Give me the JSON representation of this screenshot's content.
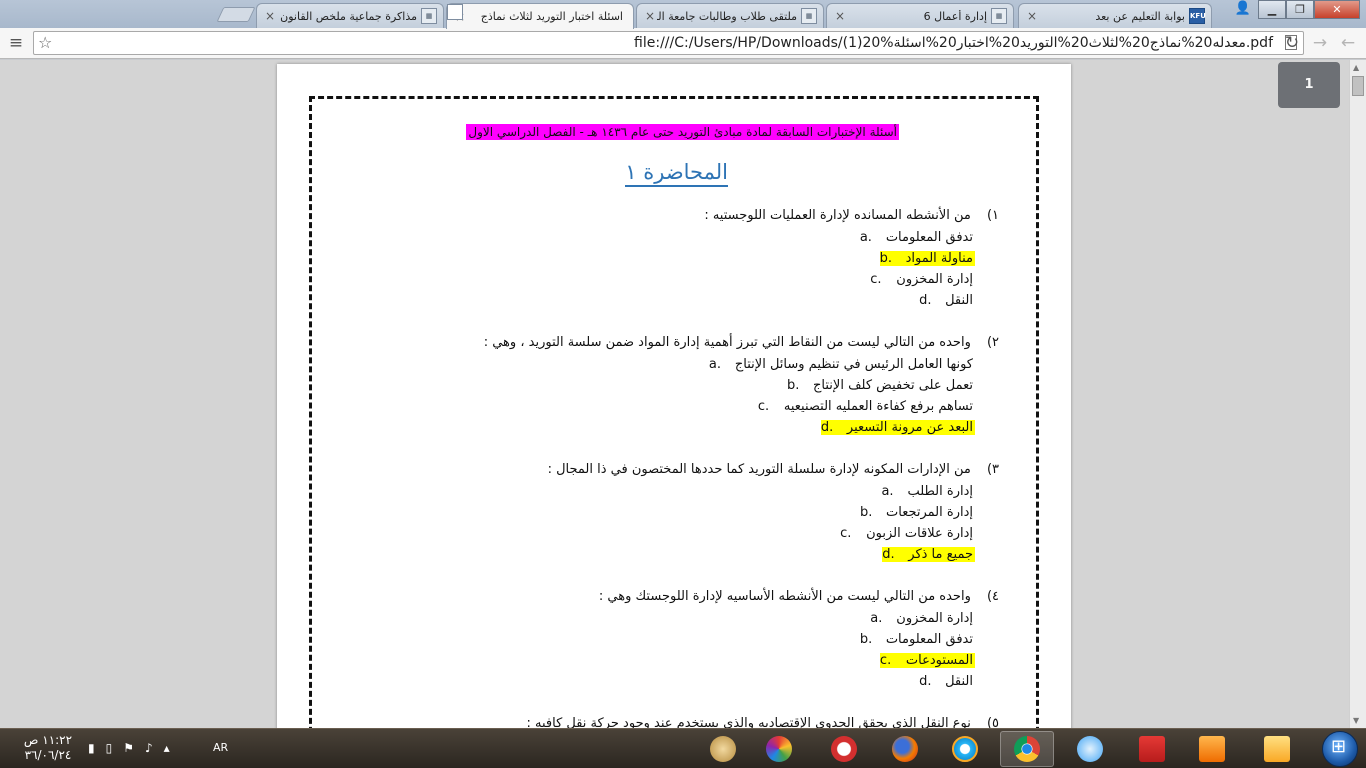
{
  "browser": {
    "tabs": [
      {
        "title": "بوابة التعليم عن بعد",
        "favicon": "KFU"
      },
      {
        "title": "إدارة أعمال 6",
        "favicon": ""
      },
      {
        "title": "ملتقى طلاب وطالبات جامعة الملك",
        "favicon": ""
      },
      {
        "title": "اسئلة اختبار التوريد لثلاث نماذج",
        "favicon": ""
      },
      {
        "title": "مذاكرة جماعية ملخص القانون التج",
        "favicon": ""
      }
    ],
    "tab_close_glyph": "×",
    "address": "file:///C:/Users/HP/Downloads/(1)20%معدله20%نماذج20%لثلاث20%التوريد20%اختبار20%اسئلة.pdf"
  },
  "viewer": {
    "page_indicator": "1",
    "document": {
      "header": "أسئلة الإختبارات السابقة لمادة مبادئ التوريد حتى عام ١٤٣٦ هـ - الفصل الدراسي الاول",
      "lecture_title": "المحاضرة ١",
      "questions": [
        {
          "num": "١)",
          "text": "من الأنشطه المسانده لإدارة العمليات اللوجستيه :",
          "options": [
            {
              "letter": "a.",
              "text": "تدفق المعلومات",
              "correct": false
            },
            {
              "letter": "b.",
              "text": "مناولة المواد",
              "correct": true
            },
            {
              "letter": "c.",
              "text": "إدارة المخزون",
              "correct": false
            },
            {
              "letter": "d.",
              "text": "النقل",
              "correct": false
            }
          ]
        },
        {
          "num": "٢)",
          "text": "واحده من التالي ليست من النقاط التي تبرز أهمية إدارة المواد ضمن سلسة التوريد ، وهي :",
          "options": [
            {
              "letter": "a.",
              "text": "كونها العامل الرئيس في تنظيم وسائل الإنتاج",
              "correct": false
            },
            {
              "letter": "b.",
              "text": "تعمل على تخفيض كلف الإنتاج",
              "correct": false
            },
            {
              "letter": "c.",
              "text": "تساهم برفع كفاءة العمليه التصنيعيه",
              "correct": false
            },
            {
              "letter": "d.",
              "text": "البعد عن مرونة التسعير",
              "correct": true
            }
          ]
        },
        {
          "num": "٣)",
          "text": "من الإدارات المكونه لإدارة سلسلة التوريد كما حددها المختصون في ذا المجال :",
          "options": [
            {
              "letter": "a.",
              "text": "إدارة الطلب",
              "correct": false
            },
            {
              "letter": "b.",
              "text": "إدارة المرتجعات",
              "correct": false
            },
            {
              "letter": "c.",
              "text": "إدارة علاقات الزبون",
              "correct": false
            },
            {
              "letter": "d.",
              "text": "جميع ما ذكر",
              "correct": true
            }
          ]
        },
        {
          "num": "٤)",
          "text": "واحده من التالي ليست من الأنشطه الأساسيه لإدارة اللوجستك وهي :",
          "options": [
            {
              "letter": "a.",
              "text": "إدارة المخزون",
              "correct": false
            },
            {
              "letter": "b.",
              "text": "تدفق المعلومات",
              "correct": false
            },
            {
              "letter": "c.",
              "text": "المستودعات",
              "correct": true
            },
            {
              "letter": "d.",
              "text": "النقل",
              "correct": false
            }
          ]
        },
        {
          "num": "٥)",
          "text": "نوع النقل الذي يحقق الجدوى الإقتصاديه والذي يستخدم عند وجود حركة نقل كافيه :",
          "options": []
        }
      ]
    }
  },
  "taskbar": {
    "time": "١١:٢٢ ص",
    "date": "٣٦/٠٦/٢٤",
    "language": "AR",
    "apps": [
      "paint-icon",
      "picasa-icon",
      "opera-icon",
      "firefox-icon",
      "ie-icon",
      "chrome-icon",
      "messenger-icon",
      "acrobat-icon",
      "media-player-icon",
      "explorer-folder-icon"
    ]
  }
}
